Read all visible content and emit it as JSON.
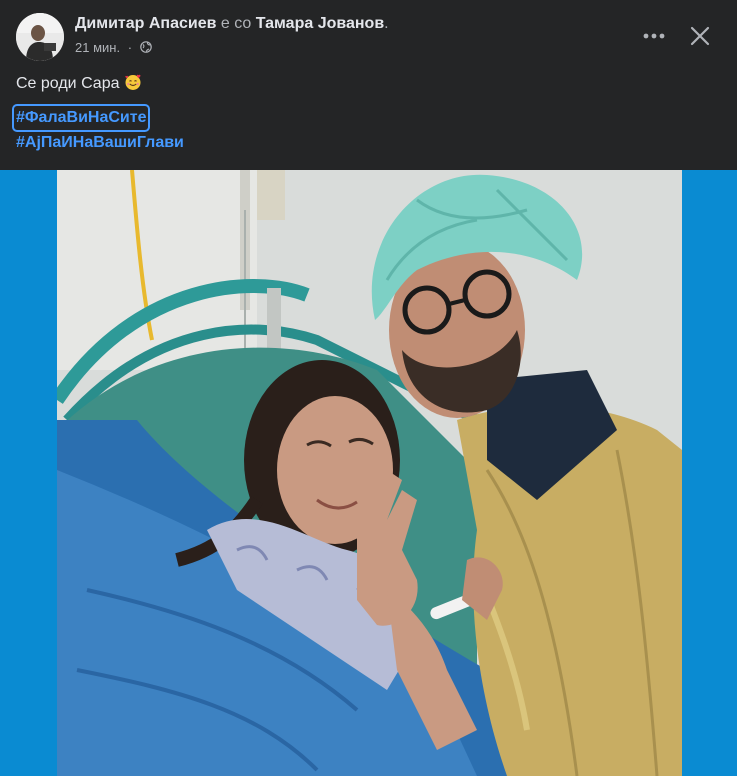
{
  "post": {
    "author": "Димитар Апасиев",
    "with_text": "е со",
    "tagged": "Тамара Јованов",
    "end_punct": ".",
    "time": "21 мин.",
    "separator": "·",
    "privacy_icon": "globe-icon",
    "text": "Се роди Сара",
    "emoji": "smiling-face-with-hearts-emoji",
    "hashtags": [
      "#ФалаВиНаСите",
      "#АјПаИНаВашиГлави"
    ]
  },
  "actions": {
    "more_icon": "more-options-icon",
    "close_icon": "close-icon"
  },
  "colors": {
    "background": "#242526",
    "text": "#e4e6eb",
    "secondary_text": "#b0b3b8",
    "link": "#4599ff",
    "photo_background": "#0a8bd2"
  }
}
